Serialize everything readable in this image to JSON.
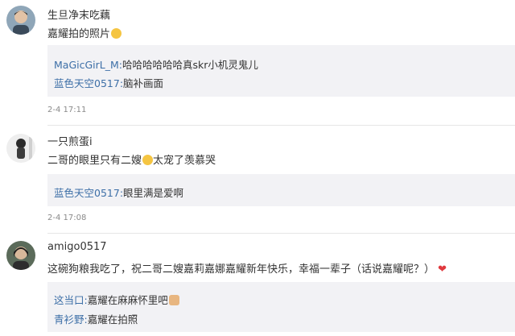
{
  "comments": [
    {
      "username": "生旦净末吃藕",
      "text": "嘉耀拍的照片",
      "emoji": "grin-emoji",
      "replies": [
        {
          "name": "MaGicGirL_M",
          "sep": ":",
          "text": "哈哈哈哈哈哈真skr小机灵鬼儿"
        },
        {
          "name": "蓝色天空0517",
          "sep": ":",
          "text": "脑补画面"
        }
      ],
      "timestamp": "2-4 17:11"
    },
    {
      "username": "一只煎蛋i",
      "text_before": "二哥的眼里只有二嫂",
      "emoji": "crying-laugh-emoji",
      "text_after": "太宠了羡慕哭",
      "replies": [
        {
          "name": "蓝色天空0517",
          "sep": ":",
          "text": "眼里满是爱啊"
        }
      ],
      "timestamp": "2-4 17:08"
    },
    {
      "username": "amigo0517",
      "text": "这碗狗粮我吃了，祝二哥二嫂嘉莉嘉娜嘉耀新年快乐，幸福一辈子（话说嘉耀呢？）",
      "emoji": "heart-emoji",
      "replies": [
        {
          "name": "这当口",
          "sep": ":",
          "text": "嘉耀在麻麻怀里吧",
          "emoji": "dog-emoji"
        },
        {
          "name": "青衫野",
          "sep": ":",
          "text": "嘉耀在拍照"
        }
      ]
    }
  ],
  "colors": {
    "username_link": "#3d6fa7",
    "reply_bg": "#f2f2f5",
    "timestamp": "#8a8a8a"
  }
}
